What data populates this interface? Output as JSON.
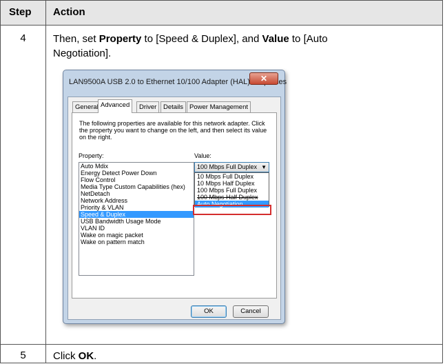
{
  "table": {
    "header_step": "Step",
    "header_action": "Action",
    "rows": [
      {
        "step": "4",
        "parts": [
          "Then, set ",
          "Property",
          " to [Speed & Duplex], and ",
          "Value",
          " to [Auto",
          "Negotiation]."
        ]
      },
      {
        "step": "5",
        "parts": [
          "Click ",
          "OK",
          "."
        ]
      }
    ]
  },
  "dialog": {
    "title": "LAN9500A USB 2.0 to Ethernet 10/100 Adapter (HAL) Properties",
    "close_glyph": "✕",
    "tabs": [
      "General",
      "Advanced",
      "Driver",
      "Details",
      "Power Management"
    ],
    "selected_tab": "Advanced",
    "description": "The following properties are available for this network adapter. Click the property you want to change on the left, and then select its value on the right.",
    "property_label": "Property:",
    "value_label": "Value:",
    "properties": [
      "Auto Mdix",
      "Energy Detect Power Down",
      "Flow Control",
      "Media Type Custom Capabilities (hex)",
      "NetDetach",
      "Network Address",
      "Priority & VLAN",
      "Speed & Duplex",
      "USB Bandwidth Usage Mode",
      "VLAN ID",
      "Wake on magic packet",
      "Wake on pattern match"
    ],
    "selected_property": "Speed & Duplex",
    "value_current": "100 Mbps Full Duplex",
    "combo_arrow": "▼",
    "value_options": [
      "10 Mbps Full Duplex",
      "10 Mbps Half Duplex",
      "100 Mbps Full Duplex",
      "100 Mbps Half Duplex",
      "Auto Negotiation"
    ],
    "highlighted_option": "Auto Negotiation",
    "ok_label": "OK",
    "cancel_label": "Cancel"
  }
}
